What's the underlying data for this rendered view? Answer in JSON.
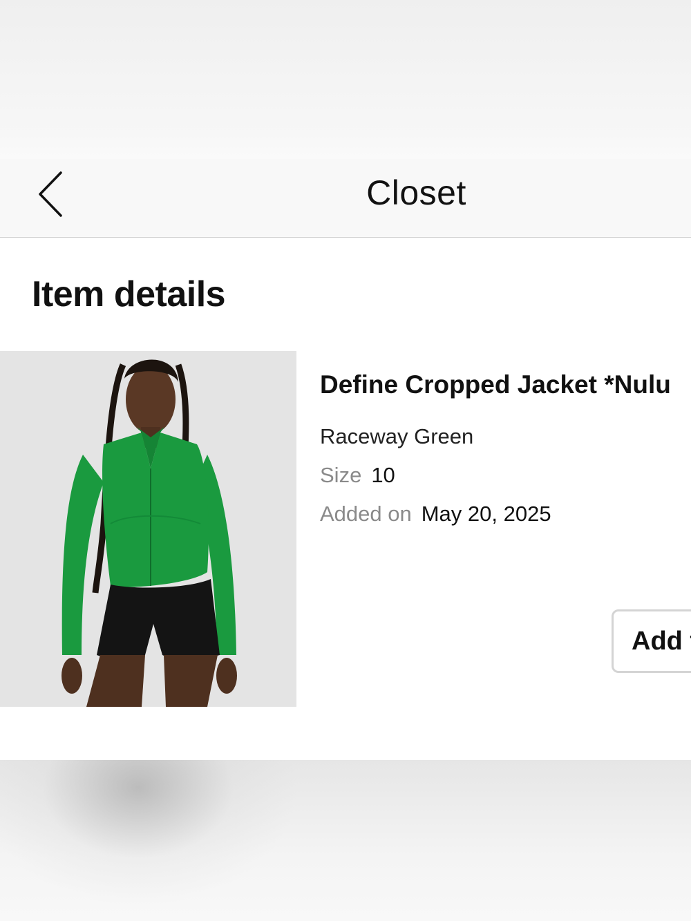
{
  "nav": {
    "title": "Closet",
    "back_icon": "chevron-left-icon"
  },
  "section": {
    "heading": "Item details"
  },
  "item": {
    "name": "Define Cropped Jacket *Nulu",
    "color": "Raceway Green",
    "size_label": "Size",
    "size_value": "10",
    "added_label": "Added on",
    "added_value": "May 20, 2025",
    "image_alt": "Model wearing green cropped jacket and black shorts"
  },
  "actions": {
    "add_label": "Add t"
  },
  "colors": {
    "jacket_green": "#1a9a3f",
    "text_primary": "#111111",
    "text_muted": "#8a8a8a"
  }
}
